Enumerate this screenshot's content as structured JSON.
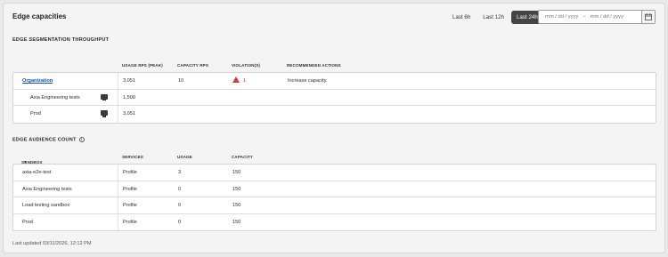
{
  "header": {
    "title": "Edge capacities",
    "ranges": [
      "Last 6h",
      "Last 12h",
      "Last 24h"
    ],
    "active_range": "Last 24h",
    "date_start_placeholder": "mm / dd / yyyy",
    "date_separator": "–",
    "date_end_placeholder": "mm / dd / yyyy"
  },
  "throughput": {
    "title": "EDGE SEGMENTATION THROUGHPUT",
    "columns": [
      "USAGE RPS (PEAK)",
      "CAPACITY RPS",
      "VIOLATION(S)",
      "RECOMMENDED ACTIONS"
    ],
    "rows": [
      {
        "name": "Organization",
        "usage": "3,051",
        "capacity": "10",
        "violations": "1",
        "action": "Increase capacity."
      },
      {
        "name": "Axia Engineering tests",
        "usage": "1,500",
        "capacity": "",
        "violations": "",
        "action": ""
      },
      {
        "name": "Prod",
        "usage": "3,051",
        "capacity": "",
        "violations": "",
        "action": ""
      }
    ]
  },
  "audience": {
    "title": "EDGE AUDIENCE COUNT",
    "info_icon": "i",
    "columns": [
      "SANDBOX",
      "SERVICES",
      "USAGE",
      "CAPACITY"
    ],
    "sort_indicator": "▼",
    "rows": [
      {
        "sandbox": "axia-e2e-test",
        "services": "Profile",
        "usage": "3",
        "capacity": "150"
      },
      {
        "sandbox": "Axia Engineering tests",
        "services": "Profile",
        "usage": "0",
        "capacity": "150"
      },
      {
        "sandbox": "Load testing sandbox",
        "services": "Profile",
        "usage": "0",
        "capacity": "150"
      },
      {
        "sandbox": "Prod",
        "services": "Profile",
        "usage": "0",
        "capacity": "150"
      }
    ]
  },
  "footer": {
    "last_updated": "Last updated 03/11/2026, 12:12 PM"
  },
  "colors": {
    "accent_link": "#1a4fb5",
    "active_range_bg": "#444444",
    "violation": "#d7373f"
  },
  "icons": {
    "sandbox_icon": "sandbox-icon",
    "warning_icon": "warning-icon",
    "calendar_icon": "calendar-icon"
  }
}
